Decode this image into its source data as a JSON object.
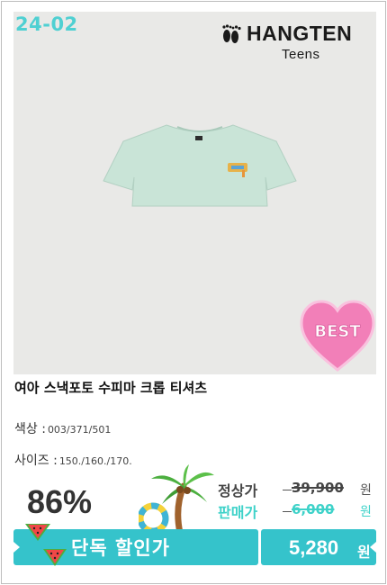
{
  "product_image": {
    "season_code": "24-02",
    "brand_name": "HANGTEN",
    "brand_sub": "Teens",
    "best_badge": "BEST",
    "shirt_color": "#c9e4d7"
  },
  "product": {
    "title": "여아 스낵포토 수피마 크롭 티셔츠",
    "color_label": "색상 :",
    "color_value": "003/371/501",
    "size_label": "사이즈 :",
    "size_value": "150./160./170."
  },
  "pricing": {
    "discount_rate": "86%",
    "normal_label": "정상가",
    "normal_price": "39,900",
    "sale_label": "판매가",
    "sale_price": "6,000",
    "currency": "원",
    "cta_label": "단독 할인가",
    "final_price": "5,280",
    "final_currency": "원"
  },
  "colors": {
    "accent": "#35c3cb",
    "sale_text": "#3ed2c9",
    "best_pink": "#f27fb8"
  }
}
